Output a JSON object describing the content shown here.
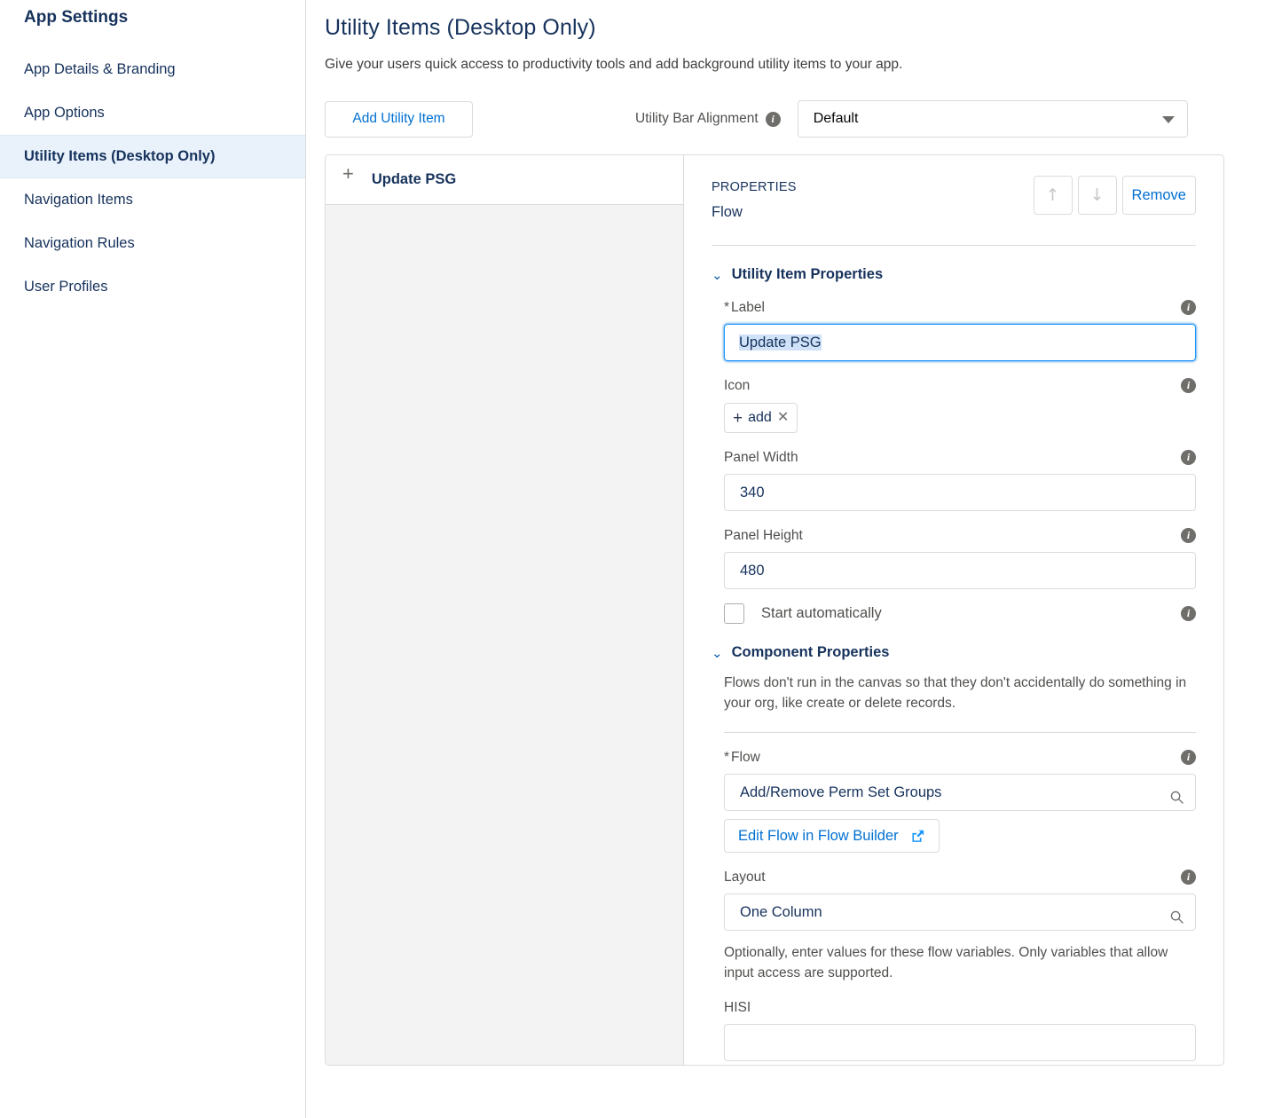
{
  "sidebar": {
    "title": "App Settings",
    "items": [
      {
        "label": "App Details & Branding"
      },
      {
        "label": "App Options"
      },
      {
        "label": "Utility Items (Desktop Only)"
      },
      {
        "label": "Navigation Items"
      },
      {
        "label": "Navigation Rules"
      },
      {
        "label": "User Profiles"
      }
    ]
  },
  "main": {
    "title": "Utility Items (Desktop Only)",
    "subtitle": "Give your users quick access to productivity tools and add background utility items to your app."
  },
  "toolbar": {
    "add_utility_item_label": "Add Utility Item",
    "alignment_label": "Utility Bar Alignment",
    "alignment_value": "Default",
    "info_glyph": "i",
    "caret_icon": "chevron-down-icon"
  },
  "utility_list": [
    {
      "label": "Update PSG",
      "icon": "plus-icon"
    }
  ],
  "properties": {
    "kicker": "PROPERTIES",
    "type": "Flow",
    "move_up_glyph": "↑",
    "move_down_glyph": "↓",
    "remove_label": "Remove",
    "chevron_glyph": "⌄"
  },
  "utility_item_properties": {
    "section_title": "Utility Item Properties",
    "label_field": {
      "label": "Label",
      "required_marker": "*",
      "value": "Update PSG",
      "placeholder": ""
    },
    "icon_field": {
      "label": "Icon",
      "pill_plus": "+",
      "pill_text": "add",
      "pill_remove": "✕"
    },
    "panel_width": {
      "label": "Panel Width",
      "value": "340"
    },
    "panel_height": {
      "label": "Panel Height",
      "value": "480"
    },
    "start_automatically": {
      "label": "Start automatically",
      "checked": false
    }
  },
  "component_properties": {
    "section_title": "Component Properties",
    "helper": "Flows don't run in the canvas so that they don't accidentally do something in your org, like create or delete records.",
    "flow_field": {
      "label": "Flow",
      "required_marker": "*",
      "value": "Add/Remove Perm Set Groups"
    },
    "edit_flow_button": {
      "label": "Edit Flow in Flow Builder",
      "icon": "external-link-icon"
    },
    "layout_field": {
      "label": "Layout",
      "value": "One Column"
    },
    "variables_helper": "Optionally, enter values for these flow variables. Only variables that allow input access are supported.",
    "hisi_field": {
      "label": "HISI",
      "value": "",
      "placeholder": ""
    }
  },
  "colors": {
    "brand_blue": "#0070d2",
    "text_navy": "#16325c",
    "border_gray": "#dddbda",
    "active_bg": "#e9f2fb",
    "panel_gray": "#f4f3f3",
    "selection_blue": "#cfe2f7"
  }
}
